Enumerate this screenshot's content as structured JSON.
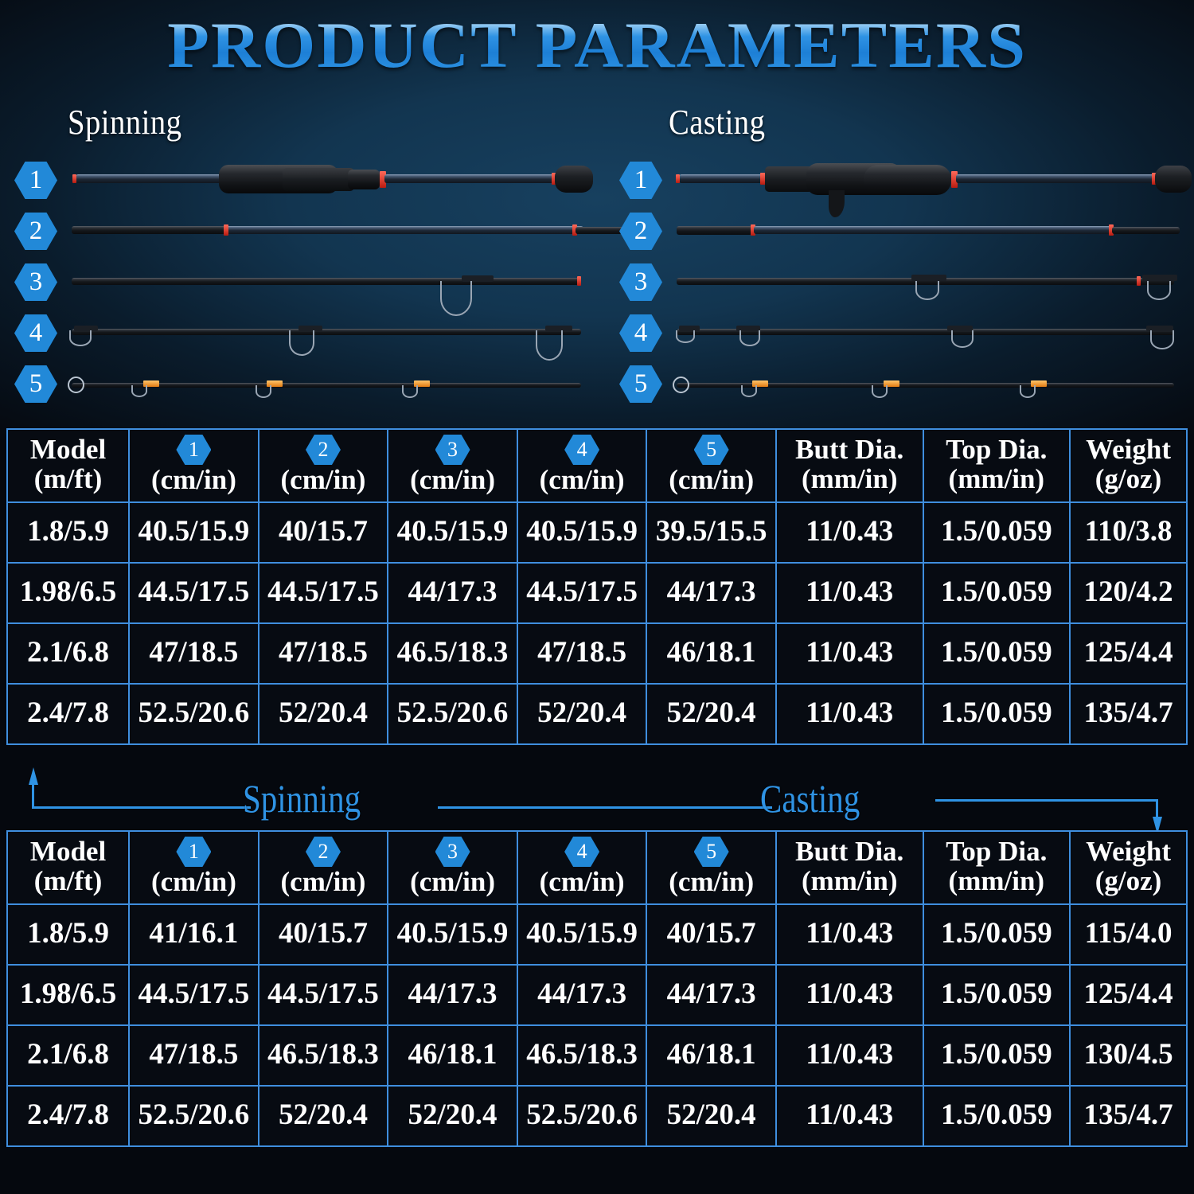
{
  "title": "PRODUCT PARAMETERS",
  "sections": {
    "spinning_label": "Spinning",
    "casting_label": "Casting"
  },
  "rod_badges": [
    "1",
    "2",
    "3",
    "4",
    "5"
  ],
  "divider": {
    "left_label": "Spinning",
    "right_label": "Casting"
  },
  "colors": {
    "accent_blue": "#2f93e4",
    "badge_blue": "#2289d8",
    "grid_border": "#3f8ede",
    "cell_background": "#070b12",
    "text_white": "#ffffff"
  },
  "table_headers": {
    "model": {
      "l1": "Model",
      "l2": "(m/ft)"
    },
    "sections": [
      {
        "badge": "1",
        "unit": "(cm/in)"
      },
      {
        "badge": "2",
        "unit": "(cm/in)"
      },
      {
        "badge": "3",
        "unit": "(cm/in)"
      },
      {
        "badge": "4",
        "unit": "(cm/in)"
      },
      {
        "badge": "5",
        "unit": "(cm/in)"
      }
    ],
    "butt_dia": {
      "l1": "Butt Dia.",
      "l2": "(mm/in)"
    },
    "top_dia": {
      "l1": "Top Dia.",
      "l2": "(mm/in)"
    },
    "weight": {
      "l1": "Weight",
      "l2": "(g/oz)"
    }
  },
  "spinning_table": {
    "caption": "Spinning",
    "rows": [
      [
        "1.8/5.9",
        "40.5/15.9",
        "40/15.7",
        "40.5/15.9",
        "40.5/15.9",
        "39.5/15.5",
        "11/0.43",
        "1.5/0.059",
        "110/3.8"
      ],
      [
        "1.98/6.5",
        "44.5/17.5",
        "44.5/17.5",
        "44/17.3",
        "44.5/17.5",
        "44/17.3",
        "11/0.43",
        "1.5/0.059",
        "120/4.2"
      ],
      [
        "2.1/6.8",
        "47/18.5",
        "47/18.5",
        "46.5/18.3",
        "47/18.5",
        "46/18.1",
        "11/0.43",
        "1.5/0.059",
        "125/4.4"
      ],
      [
        "2.4/7.8",
        "52.5/20.6",
        "52/20.4",
        "52.5/20.6",
        "52/20.4",
        "52/20.4",
        "11/0.43",
        "1.5/0.059",
        "135/4.7"
      ]
    ]
  },
  "casting_table": {
    "caption": "Casting",
    "rows": [
      [
        "1.8/5.9",
        "41/16.1",
        "40/15.7",
        "40.5/15.9",
        "40.5/15.9",
        "40/15.7",
        "11/0.43",
        "1.5/0.059",
        "115/4.0"
      ],
      [
        "1.98/6.5",
        "44.5/17.5",
        "44.5/17.5",
        "44/17.3",
        "44/17.3",
        "44/17.3",
        "11/0.43",
        "1.5/0.059",
        "125/4.4"
      ],
      [
        "2.1/6.8",
        "47/18.5",
        "46.5/18.3",
        "46/18.1",
        "46.5/18.3",
        "46/18.1",
        "11/0.43",
        "1.5/0.059",
        "130/4.5"
      ],
      [
        "2.4/7.8",
        "52.5/20.6",
        "52/20.4",
        "52/20.4",
        "52.5/20.6",
        "52/20.4",
        "11/0.43",
        "1.5/0.059",
        "135/4.7"
      ]
    ]
  }
}
